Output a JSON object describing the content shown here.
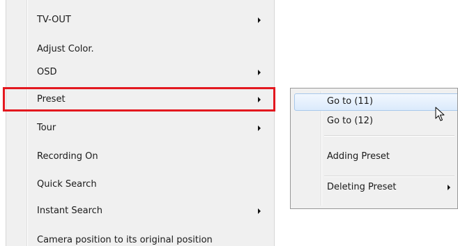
{
  "main_menu": {
    "items": [
      {
        "label": "TV-OUT",
        "has_submenu": true
      },
      {
        "label": "Adjust Color.",
        "has_submenu": false
      },
      {
        "label": "OSD",
        "has_submenu": true
      },
      {
        "label": "Preset",
        "has_submenu": true,
        "highlighted": true
      },
      {
        "label": "Tour",
        "has_submenu": true
      },
      {
        "label": "Recording On",
        "has_submenu": false
      },
      {
        "label": "Quick Search",
        "has_submenu": false
      },
      {
        "label": "Instant Search",
        "has_submenu": true
      },
      {
        "label": "Camera position to its original position",
        "has_submenu": false
      }
    ]
  },
  "submenu": {
    "items": [
      {
        "label": "Go to (11)",
        "hovered": true
      },
      {
        "label": "Go to (12)"
      },
      {
        "label": "Adding Preset"
      },
      {
        "label": "Deleting Preset",
        "has_submenu": true
      }
    ]
  },
  "colors": {
    "highlight_border": "#e3181f",
    "menu_background": "#f0f0f0",
    "hover_border": "#a8c8eb"
  },
  "icons": {
    "submenu_arrow": "triangle-right",
    "cursor": "arrow-pointer"
  }
}
